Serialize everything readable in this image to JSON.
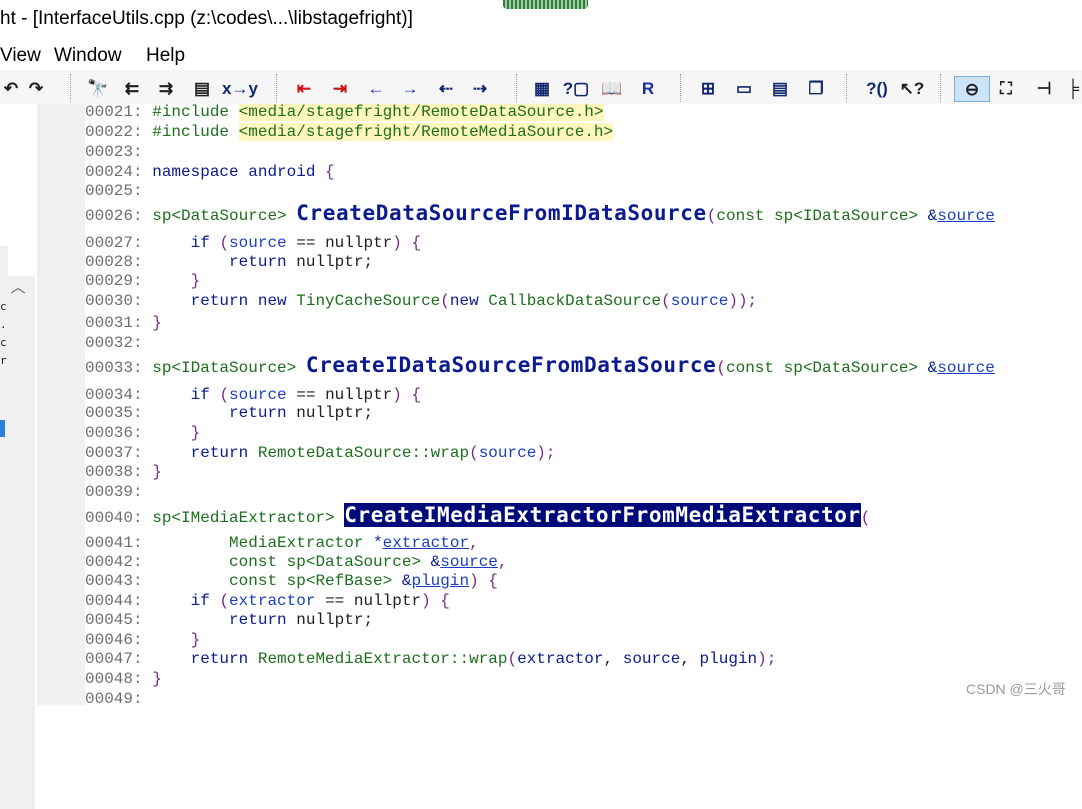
{
  "window": {
    "title": "ht - [InterfaceUtils.cpp (z:\\codes\\...\\libstagefright)]"
  },
  "menu": {
    "items": [
      "View",
      "Window",
      "Help"
    ]
  },
  "toolbar": {
    "buttons": [
      {
        "icon": "undo-icon",
        "glyph": "↶"
      },
      {
        "icon": "redo-icon",
        "glyph": "↷"
      },
      {
        "icon": "find-binoculars-icon",
        "glyph": "🔭"
      },
      {
        "icon": "find-prev-icon",
        "glyph": "⇇"
      },
      {
        "icon": "find-next-icon",
        "glyph": "⇉"
      },
      {
        "icon": "find-in-files-icon",
        "glyph": "▤"
      },
      {
        "icon": "replace-icon",
        "glyph": "x→y"
      },
      {
        "icon": "bookmark-prev-icon",
        "glyph": "⇤"
      },
      {
        "icon": "bookmark-next-icon",
        "glyph": "⇥"
      },
      {
        "icon": "nav-back-icon",
        "glyph": "←"
      },
      {
        "icon": "nav-forward-icon",
        "glyph": "→"
      },
      {
        "icon": "jump-prev-icon",
        "glyph": "⇠"
      },
      {
        "icon": "jump-next-icon",
        "glyph": "⇢"
      },
      {
        "icon": "symbol-window-icon",
        "glyph": "▦"
      },
      {
        "icon": "context-help-icon",
        "glyph": "?▢"
      },
      {
        "icon": "book-icon",
        "glyph": "📖"
      },
      {
        "icon": "relation-icon",
        "glyph": "R"
      },
      {
        "icon": "layout-grid-icon",
        "glyph": "⊞"
      },
      {
        "icon": "layout-panel-icon",
        "glyph": "▭"
      },
      {
        "icon": "layout-split-icon",
        "glyph": "▤"
      },
      {
        "icon": "layout-cascade-icon",
        "glyph": "❐"
      },
      {
        "icon": "function-help-icon",
        "glyph": "?()"
      },
      {
        "icon": "pointer-help-icon",
        "glyph": "↖?"
      },
      {
        "icon": "lookup-active-icon",
        "glyph": "⊖"
      },
      {
        "icon": "frame-icon",
        "glyph": "⛶"
      },
      {
        "icon": "tree-icon",
        "glyph": "⊣"
      },
      {
        "icon": "more-icon",
        "glyph": "╞"
      }
    ]
  },
  "colors": {
    "keyword": "#0c1a8f",
    "type": "#1d6e1d",
    "punct": "#7a2a8a",
    "selection": "#000a78",
    "header_highlight": "#fff6bd"
  },
  "code": {
    "lines": [
      {
        "n": "00021:",
        "segs": [
          [
            "ty",
            "#include "
          ],
          [
            "hdr",
            "<media/stagefright/RemoteDataSource.h>"
          ]
        ]
      },
      {
        "n": "00022:",
        "segs": [
          [
            "ty",
            "#include "
          ],
          [
            "hdr",
            "<media/stagefright/RemoteMediaSource.h>"
          ]
        ]
      },
      {
        "n": "00023:",
        "segs": []
      },
      {
        "n": "00024:",
        "segs": [
          [
            "kw",
            "namespace android "
          ],
          [
            "pn",
            "{"
          ]
        ]
      },
      {
        "n": "00025:",
        "segs": []
      },
      {
        "n": "00026:",
        "segs": [
          [
            "ty",
            "sp<DataSource> "
          ],
          [
            "fn",
            "CreateDataSourceFromIDataSource"
          ],
          [
            "pn",
            "("
          ],
          [
            "ty",
            "const sp<IDataSource> "
          ],
          [
            "kw",
            "&"
          ],
          [
            "par ul",
            "source"
          ]
        ]
      },
      {
        "n": "00027:",
        "segs": [
          [
            "id",
            "    "
          ],
          [
            "kw",
            "if "
          ],
          [
            "pn",
            "("
          ],
          [
            "par",
            "source"
          ],
          [
            "id",
            " == nullptr"
          ],
          [
            "pn",
            ") {"
          ]
        ]
      },
      {
        "n": "00028:",
        "segs": [
          [
            "id",
            "        "
          ],
          [
            "kw",
            "return "
          ],
          [
            "id",
            "nullptr;"
          ]
        ]
      },
      {
        "n": "00029:",
        "segs": [
          [
            "id",
            "    "
          ],
          [
            "pn",
            "}"
          ]
        ]
      },
      {
        "n": "00030:",
        "segs": [
          [
            "id",
            "    "
          ],
          [
            "kw",
            "return new "
          ],
          [
            "ty",
            "TinyCacheSource"
          ],
          [
            "pn",
            "("
          ],
          [
            "kw",
            "new "
          ],
          [
            "ty",
            "CallbackDataSource"
          ],
          [
            "pn",
            "("
          ],
          [
            "par",
            "source"
          ],
          [
            "pn",
            "));"
          ]
        ]
      },
      {
        "n": "00031:",
        "segs": [
          [
            "pn",
            "}"
          ]
        ]
      },
      {
        "n": "00032:",
        "segs": []
      },
      {
        "n": "00033:",
        "segs": [
          [
            "ty",
            "sp<IDataSource> "
          ],
          [
            "fn",
            "CreateIDataSourceFromDataSource"
          ],
          [
            "pn",
            "("
          ],
          [
            "ty",
            "const sp<DataSource> "
          ],
          [
            "kw",
            "&"
          ],
          [
            "par ul",
            "source"
          ]
        ]
      },
      {
        "n": "00034:",
        "segs": [
          [
            "id",
            "    "
          ],
          [
            "kw",
            "if "
          ],
          [
            "pn",
            "("
          ],
          [
            "par",
            "source"
          ],
          [
            "id",
            " == nullptr"
          ],
          [
            "pn",
            ") {"
          ]
        ]
      },
      {
        "n": "00035:",
        "segs": [
          [
            "id",
            "        "
          ],
          [
            "kw",
            "return "
          ],
          [
            "id",
            "nullptr;"
          ]
        ]
      },
      {
        "n": "00036:",
        "segs": [
          [
            "id",
            "    "
          ],
          [
            "pn",
            "}"
          ]
        ]
      },
      {
        "n": "00037:",
        "segs": [
          [
            "id",
            "    "
          ],
          [
            "kw",
            "return "
          ],
          [
            "ty",
            "RemoteDataSource::wrap"
          ],
          [
            "pn",
            "("
          ],
          [
            "par",
            "source"
          ],
          [
            "pn",
            ");"
          ]
        ]
      },
      {
        "n": "00038:",
        "segs": [
          [
            "pn",
            "}"
          ]
        ]
      },
      {
        "n": "00039:",
        "segs": []
      },
      {
        "n": "00040:",
        "segs": [
          [
            "ty",
            "sp<IMediaExtractor> "
          ],
          [
            "fn sel",
            "CreateIMediaExtractorFromMediaExtractor"
          ],
          [
            "pn",
            "("
          ]
        ]
      },
      {
        "n": "00041:",
        "segs": [
          [
            "id",
            "        "
          ],
          [
            "ty",
            "MediaExtractor "
          ],
          [
            "kw",
            "*"
          ],
          [
            "par ul",
            "extractor"
          ],
          [
            "pn",
            ","
          ]
        ]
      },
      {
        "n": "00042:",
        "segs": [
          [
            "id",
            "        "
          ],
          [
            "ty",
            "const sp<DataSource> "
          ],
          [
            "kw",
            "&"
          ],
          [
            "par ul",
            "source"
          ],
          [
            "pn",
            ","
          ]
        ]
      },
      {
        "n": "00043:",
        "segs": [
          [
            "id",
            "        "
          ],
          [
            "ty",
            "const sp<RefBase> "
          ],
          [
            "kw",
            "&"
          ],
          [
            "par ul",
            "plugin"
          ],
          [
            "pn",
            ") {"
          ]
        ]
      },
      {
        "n": "00044:",
        "segs": [
          [
            "id",
            "    "
          ],
          [
            "kw",
            "if "
          ],
          [
            "pn",
            "("
          ],
          [
            "par",
            "extractor"
          ],
          [
            "id",
            " == nullptr"
          ],
          [
            "pn",
            ") {"
          ]
        ]
      },
      {
        "n": "00045:",
        "segs": [
          [
            "id",
            "        "
          ],
          [
            "kw",
            "return "
          ],
          [
            "id",
            "nullptr;"
          ]
        ]
      },
      {
        "n": "00046:",
        "segs": [
          [
            "id",
            "    "
          ],
          [
            "pn",
            "}"
          ]
        ]
      },
      {
        "n": "00047:",
        "segs": [
          [
            "id",
            "    "
          ],
          [
            "kw",
            "return "
          ],
          [
            "ty",
            "RemoteMediaExtractor::wrap"
          ],
          [
            "pn",
            "("
          ],
          [
            "kw",
            "extractor"
          ],
          [
            "id",
            ", "
          ],
          [
            "kw",
            "source"
          ],
          [
            "id",
            ", "
          ],
          [
            "kw",
            "plugin"
          ],
          [
            "pn",
            ");"
          ]
        ]
      },
      {
        "n": "00048:",
        "segs": [
          [
            "pn",
            "}"
          ]
        ]
      },
      {
        "n": "00049:",
        "segs": []
      }
    ]
  },
  "side_panel": {
    "chars": [
      "c",
      ".",
      "c",
      "r"
    ]
  },
  "watermark": "CSDN @三火哥"
}
